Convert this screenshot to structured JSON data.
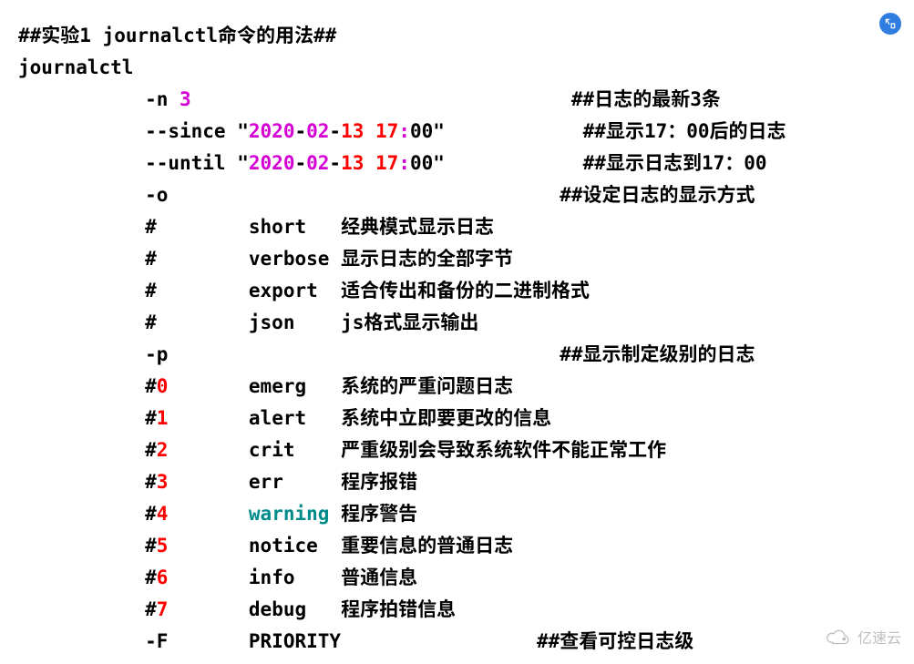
{
  "title": "##实验1 journalctl命令的用法##",
  "command": "journalctl",
  "n_line": {
    "indent": "           ",
    "flag": "-n ",
    "arg": "3",
    "pad": "                                 ",
    "comment": "##日志的最新3条"
  },
  "since": {
    "indent": "           ",
    "flag": "--since ",
    "q1": "\"",
    "year": "2020",
    "d1": "-",
    "month": "02",
    "d2": "-",
    "day": "13",
    "sp": " ",
    "hour": "17",
    "colon": ":",
    "min": "00",
    "q2": "\"",
    "pad": "            ",
    "comment": "##显示17：00后的日志"
  },
  "until": {
    "indent": "           ",
    "flag": "--until ",
    "q1": "\"",
    "year": "2020",
    "d1": "-",
    "month": "02",
    "d2": "-",
    "day": "13",
    "sp": " ",
    "hour": "17",
    "colon": ":",
    "min": "00",
    "q2": "\"",
    "pad": "            ",
    "comment": "##显示日志到17：00"
  },
  "o_line": {
    "indent": "           ",
    "flag": "-o",
    "pad": "                                  ",
    "comment": "##设定日志的显示方式"
  },
  "o_modes": [
    {
      "indent": "           ",
      "mark": "#",
      "pad1": "        ",
      "mode": "short  ",
      "pad2": " ",
      "desc": "经典模式显示日志"
    },
    {
      "indent": "           ",
      "mark": "#",
      "pad1": "        ",
      "mode": "verbose",
      "pad2": " ",
      "desc": "显示日志的全部字节"
    },
    {
      "indent": "           ",
      "mark": "#",
      "pad1": "        ",
      "mode": "export ",
      "pad2": " ",
      "desc": "适合传出和备份的二进制格式"
    },
    {
      "indent": "           ",
      "mark": "#",
      "pad1": "        ",
      "mode": "json   ",
      "pad2": " ",
      "desc": "js格式显示输出"
    }
  ],
  "p_line": {
    "indent": "           ",
    "flag": "-p",
    "pad": "                                  ",
    "comment": "##显示制定级别的日志"
  },
  "levels": [
    {
      "indent": "           ",
      "mark": "#",
      "num": "0",
      "pad1": "       ",
      "name": "emerg  ",
      "pad2": " ",
      "desc": "系统的严重问题日志",
      "name_class": "c-black"
    },
    {
      "indent": "           ",
      "mark": "#",
      "num": "1",
      "pad1": "       ",
      "name": "alert  ",
      "pad2": " ",
      "desc": "系统中立即要更改的信息",
      "name_class": "c-black"
    },
    {
      "indent": "           ",
      "mark": "#",
      "num": "2",
      "pad1": "       ",
      "name": "crit   ",
      "pad2": " ",
      "desc": "严重级别会导致系统软件不能正常工作",
      "name_class": "c-black"
    },
    {
      "indent": "           ",
      "mark": "#",
      "num": "3",
      "pad1": "       ",
      "name": "err    ",
      "pad2": " ",
      "desc": "程序报错",
      "name_class": "c-black"
    },
    {
      "indent": "           ",
      "mark": "#",
      "num": "4",
      "pad1": "       ",
      "name": "warning",
      "pad2": " ",
      "desc": "程序警告",
      "name_class": "c-teal"
    },
    {
      "indent": "           ",
      "mark": "#",
      "num": "5",
      "pad1": "       ",
      "name": "notice ",
      "pad2": " ",
      "desc": "重要信息的普通日志",
      "name_class": "c-black"
    },
    {
      "indent": "           ",
      "mark": "#",
      "num": "6",
      "pad1": "       ",
      "name": "info   ",
      "pad2": " ",
      "desc": "普通信息",
      "name_class": "c-black"
    },
    {
      "indent": "           ",
      "mark": "#",
      "num": "7",
      "pad1": "       ",
      "name": "debug  ",
      "pad2": " ",
      "desc": "程序拍错信息",
      "name_class": "c-black"
    }
  ],
  "f_line": {
    "indent": "           ",
    "flag": "-F",
    "pad1": "       ",
    "arg": "PRIORITY",
    "pad2": "                 ",
    "comment": "##查看可控日志级"
  },
  "watermark": "亿速云"
}
